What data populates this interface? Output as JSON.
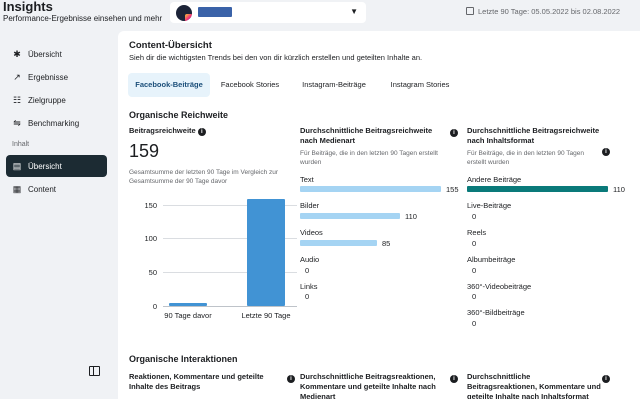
{
  "header": {
    "title": "Insights",
    "subtitle": "Performance-Ergebnisse einsehen und mehr",
    "date_range": "Letzte 90 Tage: 05.05.2022 bis 02.08.2022"
  },
  "sidebar": {
    "items": [
      {
        "label": "Übersicht",
        "icon": "asterisk-icon"
      },
      {
        "label": "Ergebnisse",
        "icon": "trend-icon"
      },
      {
        "label": "Zielgruppe",
        "icon": "audience-icon"
      },
      {
        "label": "Benchmarking",
        "icon": "benchmark-icon"
      }
    ],
    "section_label": "Inhalt",
    "content_items": [
      {
        "label": "Übersicht",
        "icon": "overview-icon",
        "active": true
      },
      {
        "label": "Content",
        "icon": "table-icon"
      }
    ]
  },
  "card": {
    "title": "Content-Übersicht",
    "description": "Sieh dir die wichtigsten Trends bei den von dir kürzlich erstellen und geteilten Inhalte an.",
    "tabs": [
      {
        "label": "Facebook-Beiträge",
        "active": true
      },
      {
        "label": "Facebook Stories"
      },
      {
        "label": "Instagram-Beiträge"
      },
      {
        "label": "Instagram Stories"
      }
    ]
  },
  "reach": {
    "section_title": "Organische Reichweite",
    "metric_title": "Beitragsreichweite",
    "value": "159",
    "note": "Gesamtsumme der letzten 90 Tage im Vergleich zur Gesamtsumme der 90 Tage davor",
    "by_media_title": "Durchschnittliche Beitragsreichweite nach Medienart",
    "by_media_note": "Für Beiträge, die in den letzten 90 Tagen erstellt wurden",
    "by_format_title": "Durchschnittliche Beitragsreichweite nach Inhaltsformat",
    "by_format_note": "Für Beiträge, die in den letzten 90 Tagen erstellt wurden"
  },
  "interactions": {
    "section_title": "Organische Interaktionen",
    "metric_title": "Reaktionen, Kommentare und geteilte Inhalte des Beitrags",
    "by_media_title": "Durchschnittliche Beitragsreaktionen, Kommentare und geteilte Inhalte nach Medienart",
    "by_format_title": "Durchschnittliche Beitragsreaktionen, Kommentare und geteilte Inhalte nach Inhaltsformat"
  },
  "colors": {
    "bar_blue": "#4193d4",
    "bar_light": "#a5d4f3",
    "bar_teal": "#0a7a7a",
    "active_nav": "#1c2b33"
  },
  "chart_data": [
    {
      "type": "bar",
      "categories": [
        "90 Tage davor",
        "Letzte 90 Tage"
      ],
      "values": [
        4,
        159
      ],
      "yticks": [
        "150",
        "100",
        "50",
        "0"
      ],
      "ylim": [
        0,
        160
      ]
    },
    {
      "type": "bar",
      "orientation": "horizontal",
      "categories": [
        "Text",
        "Bilder",
        "Videos",
        "Audio",
        "Links"
      ],
      "values": [
        155,
        110,
        85,
        0,
        0
      ]
    },
    {
      "type": "bar",
      "orientation": "horizontal",
      "categories": [
        "Andere Beiträge",
        "Live-Beiträge",
        "Reels",
        "Albumbeiträge",
        "360°-Videobeiträge",
        "360°-Bildbeiträge"
      ],
      "values": [
        110,
        0,
        0,
        0,
        0,
        0
      ]
    }
  ]
}
